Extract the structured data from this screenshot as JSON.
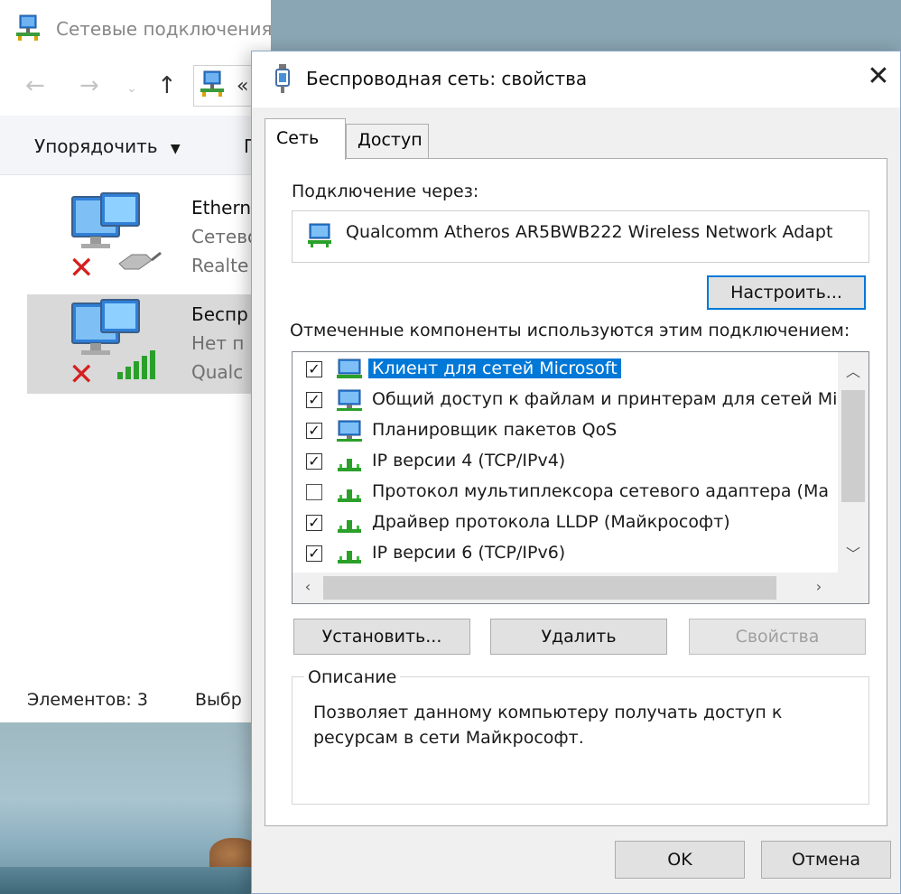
{
  "explorer": {
    "title": "Сетевые подключения",
    "address_text": "«",
    "toolbar": {
      "organize_label": "Упорядочить",
      "second_label": "П"
    },
    "connections": [
      {
        "name": "Ethern",
        "status": "Сетево",
        "adapter": "Realte"
      },
      {
        "name": "Беспр",
        "status": "Нет п",
        "adapter": "Qualc"
      }
    ],
    "statusbar": {
      "items_label": "Элементов: 3",
      "selected_label": "Выбр"
    }
  },
  "dialog": {
    "title": "Беспроводная сеть: свойства",
    "close_label": "✕",
    "tabs": [
      {
        "label": "Сеть",
        "active": true
      },
      {
        "label": "Доступ",
        "active": false
      }
    ],
    "connect_via_label": "Подключение через:",
    "adapter_name": "Qualcomm Atheros AR5BWB222 Wireless Network Adapt",
    "configure_button": "Настроить...",
    "components_label": "Отмеченные компоненты используются этим подключением:",
    "components": [
      {
        "label": "Клиент для сетей Microsoft",
        "checked": true,
        "selected": true,
        "icon": "network-client-icon"
      },
      {
        "label": "Общий доступ к файлам и принтерам для сетей Mi",
        "checked": true,
        "selected": false,
        "icon": "network-service-icon"
      },
      {
        "label": "Планировщик пакетов QoS",
        "checked": true,
        "selected": false,
        "icon": "network-service-icon"
      },
      {
        "label": "IP версии 4 (TCP/IPv4)",
        "checked": true,
        "selected": false,
        "icon": "network-protocol-icon"
      },
      {
        "label": "Протокол мультиплексора сетевого адаптера (Ma",
        "checked": false,
        "selected": false,
        "icon": "network-protocol-icon"
      },
      {
        "label": "Драйвер протокола LLDP (Майкрософт)",
        "checked": true,
        "selected": false,
        "icon": "network-protocol-icon"
      },
      {
        "label": "IP версии 6 (TCP/IPv6)",
        "checked": true,
        "selected": false,
        "icon": "network-protocol-icon"
      }
    ],
    "install_button": "Установить...",
    "remove_button": "Удалить",
    "properties_button": "Свойства",
    "description_legend": "Описание",
    "description_text": "Позволяет данному компьютеру получать доступ к ресурсам в сети Майкрософт.",
    "ok_button": "OK",
    "cancel_button": "Отмена"
  },
  "colors": {
    "selection": "#0078d7",
    "dialog_bg": "#f0f0f0",
    "window_border": "#8aa7c8"
  }
}
